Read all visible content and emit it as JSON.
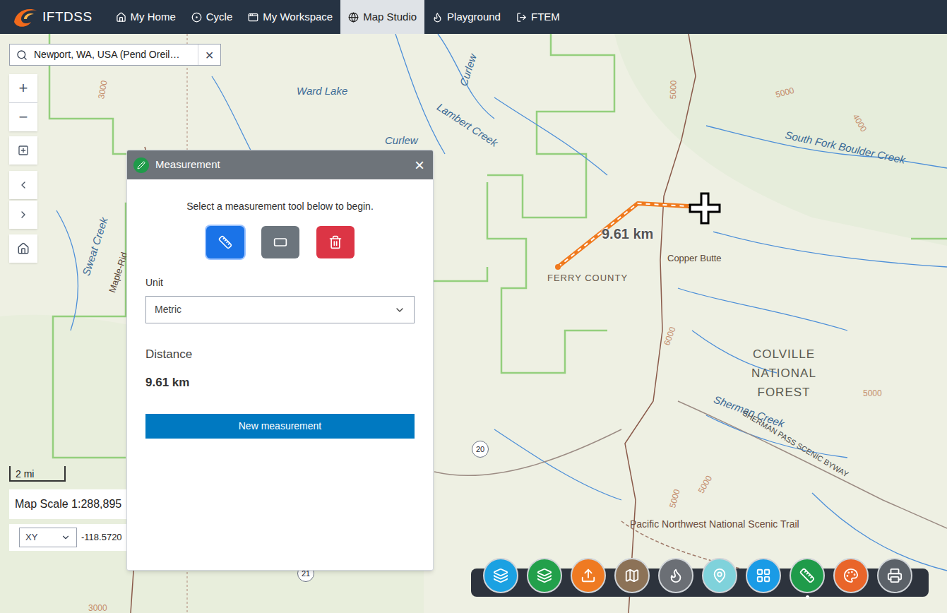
{
  "app": {
    "name": "IFTDSS"
  },
  "nav": [
    {
      "label": "My Home",
      "selected": false
    },
    {
      "label": "Cycle",
      "selected": false
    },
    {
      "label": "My Workspace",
      "selected": false
    },
    {
      "label": "Map Studio",
      "selected": true
    },
    {
      "label": "Playground",
      "selected": false
    },
    {
      "label": "FTEM",
      "selected": false
    }
  ],
  "search": {
    "value": "Newport, WA, USA (Pend Oreil…",
    "clear": "×"
  },
  "zoom": {
    "in": "+",
    "out": "−"
  },
  "map_labels": [
    {
      "text": "Ward Lake",
      "kind": "water"
    },
    {
      "text": "Curlew",
      "kind": "water"
    },
    {
      "text": "Curlew",
      "kind": "water"
    },
    {
      "text": "Lambert Creek",
      "kind": "water"
    },
    {
      "text": "South Fork Boulder Creek",
      "kind": "water"
    },
    {
      "text": "Copper Butte",
      "kind": "place"
    },
    {
      "text": "FERRY COUNTY",
      "kind": "county"
    },
    {
      "text": "COLVILLE NATIONAL FOREST",
      "kind": "region"
    },
    {
      "text": "Sherman Creek",
      "kind": "water"
    },
    {
      "text": "SHERMAN PASS SCENIC BYWAY",
      "kind": "road"
    },
    {
      "text": "Pacific Northwest National Scenic Trail",
      "kind": "trail"
    },
    {
      "text": "Sweat Creek",
      "kind": "water"
    },
    {
      "text": "Maple-Rid",
      "kind": "place"
    },
    {
      "text": "3000",
      "kind": "contour"
    },
    {
      "text": "5000",
      "kind": "contour"
    },
    {
      "text": "5000",
      "kind": "contour"
    },
    {
      "text": "4000",
      "kind": "contour"
    },
    {
      "text": "6000",
      "kind": "contour"
    },
    {
      "text": "5000",
      "kind": "contour"
    },
    {
      "text": "5000",
      "kind": "contour"
    },
    {
      "text": "5000",
      "kind": "contour"
    },
    {
      "text": "3000",
      "kind": "contour"
    },
    {
      "text": "20",
      "kind": "shield"
    },
    {
      "text": "21",
      "kind": "shield"
    }
  ],
  "measurement_line": {
    "label": "9.61 km"
  },
  "scale": {
    "bar": "2 mi",
    "text": "Map Scale 1:288,895"
  },
  "coordinates": {
    "system": "XY",
    "value": "-118.5720"
  },
  "measurement_panel": {
    "title": "Measurement",
    "close": "×",
    "hint": "Select a measurement tool below to begin.",
    "tools": [
      {
        "kind": "distance",
        "selected": true,
        "color": "#1a73e8"
      },
      {
        "kind": "area",
        "selected": false,
        "color": "#6c757d"
      },
      {
        "kind": "clear",
        "selected": false,
        "color": "#dc3545"
      }
    ],
    "unit_label": "Unit",
    "unit": "Metric",
    "result_label": "Distance",
    "result": "9.61 km",
    "button": "New measurement"
  },
  "toolbar": [
    {
      "kind": "layers",
      "selected": false,
      "color": "#1ba1e2"
    },
    {
      "kind": "add-layer",
      "selected": false,
      "color": "#22a04b"
    },
    {
      "kind": "upload",
      "selected": false,
      "color": "#ef7a22"
    },
    {
      "kind": "legend",
      "selected": false,
      "color": "#8c7257"
    },
    {
      "kind": "fire",
      "selected": false,
      "color": "#6b6f75"
    },
    {
      "kind": "pin",
      "selected": false,
      "color": "#7fd2db"
    },
    {
      "kind": "grid",
      "selected": false,
      "color": "#1a9be6"
    },
    {
      "kind": "measure",
      "selected": true,
      "color": "#1f9b4a"
    },
    {
      "kind": "palette",
      "selected": false,
      "color": "#e9652a"
    },
    {
      "kind": "print",
      "selected": false,
      "color": "#5b6168"
    }
  ]
}
